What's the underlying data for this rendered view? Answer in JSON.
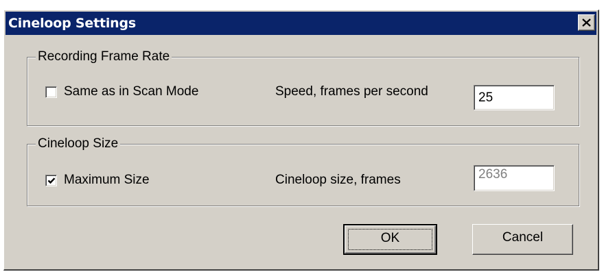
{
  "window": {
    "title": "Cineloop Settings",
    "close_icon": "close-icon"
  },
  "recording_frame_rate": {
    "group_label": "Recording Frame Rate",
    "same_as_scan_mode": {
      "label": "Same as in Scan Mode",
      "checked": false
    },
    "speed_label": "Speed, frames per second",
    "speed_value": "25"
  },
  "cineloop_size": {
    "group_label": "Cineloop Size",
    "maximum_size": {
      "label": "Maximum Size",
      "checked": true
    },
    "size_label": "Cineloop size, frames",
    "size_value": "2636",
    "size_enabled": false
  },
  "buttons": {
    "ok_label": "OK",
    "cancel_label": "Cancel"
  },
  "colors": {
    "titlebar": "#0a246a",
    "face": "#d4d0c8"
  }
}
